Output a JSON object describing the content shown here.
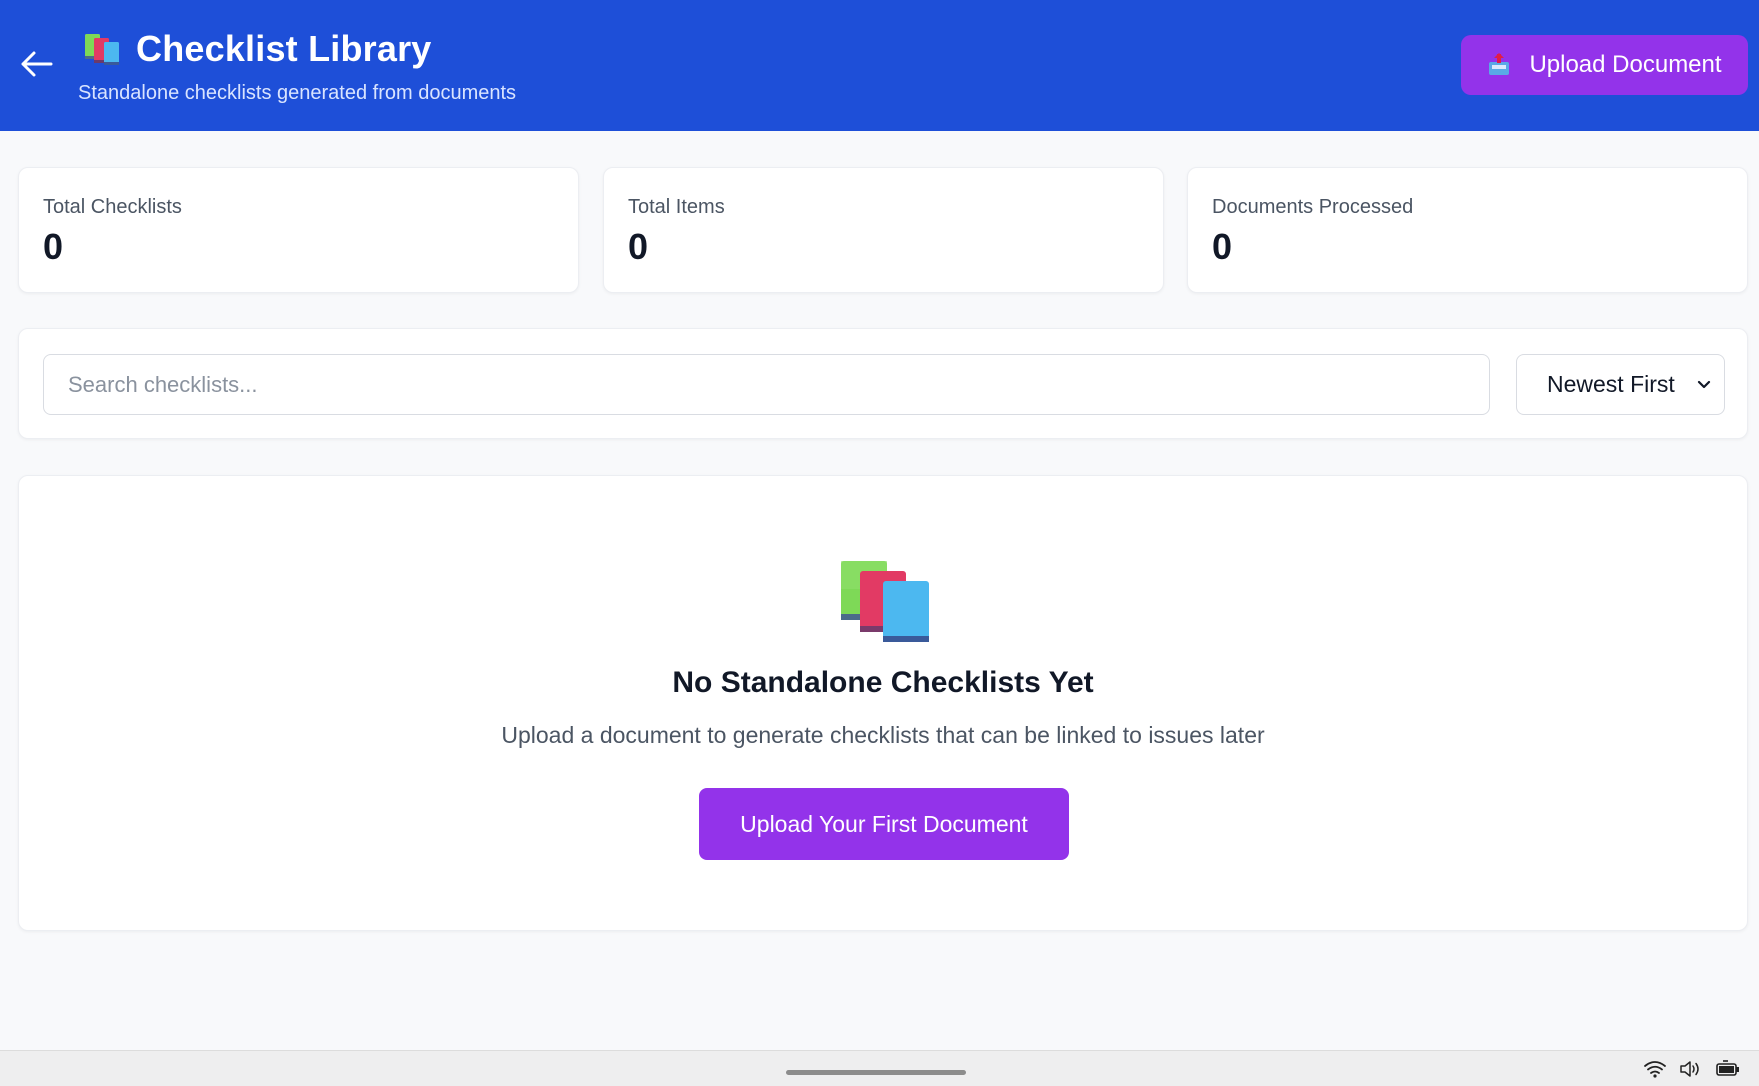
{
  "header": {
    "title": "Checklist Library",
    "subtitle": "Standalone checklists generated from documents",
    "upload_label": "Upload Document",
    "back_icon": "arrow-left-icon",
    "title_icon": "books-icon",
    "upload_icon": "inbox-upload-icon",
    "background": "#1e4fd8",
    "accent": "#9333ea"
  },
  "stats": [
    {
      "label": "Total Checklists",
      "value": "0"
    },
    {
      "label": "Total Items",
      "value": "0"
    },
    {
      "label": "Documents Processed",
      "value": "0"
    }
  ],
  "filters": {
    "search_placeholder": "Search checklists...",
    "sort_selected": "Newest First"
  },
  "empty_state": {
    "icon": "books-icon",
    "title": "No Standalone Checklists Yet",
    "description": "Upload a document to generate checklists that can be linked to issues later",
    "button_label": "Upload Your First Document"
  },
  "system_tray": {
    "icons": [
      "wifi-icon",
      "volume-icon",
      "battery-icon"
    ]
  }
}
